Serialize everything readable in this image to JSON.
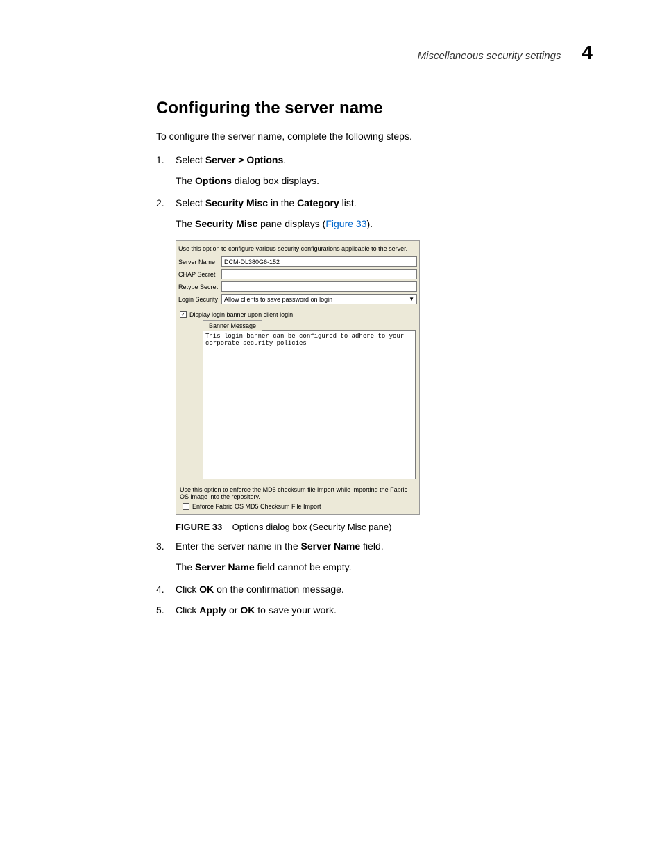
{
  "header": {
    "section_title": "Miscellaneous security settings",
    "chapter_number": "4"
  },
  "h1": "Configuring the server name",
  "intro": "To configure the server name, complete the following steps.",
  "steps": {
    "s1": {
      "num": "1.",
      "prefix": "Select ",
      "bold": "Server > Options",
      "suffix": ".",
      "result_pre": "The ",
      "result_bold": "Options",
      "result_post": " dialog box displays."
    },
    "s2": {
      "num": "2.",
      "prefix": "Select ",
      "bold1": "Security Misc",
      "mid": " in the ",
      "bold2": "Category",
      "suffix": " list.",
      "result_pre": "The ",
      "result_bold": "Security Misc",
      "result_mid": " pane displays (",
      "result_link": "Figure 33",
      "result_post": ")."
    },
    "s3": {
      "num": "3.",
      "prefix": "Enter the server name in the ",
      "bold": "Server Name",
      "suffix": " field.",
      "result_pre": "The ",
      "result_bold": "Server Name",
      "result_post": " field cannot be empty."
    },
    "s4": {
      "num": "4.",
      "prefix": "Click ",
      "bold": "OK",
      "suffix": " on the confirmation message."
    },
    "s5": {
      "num": "5.",
      "prefix": "Click ",
      "bold1": "Apply",
      "mid": " or ",
      "bold2": "OK",
      "suffix": " to save your work."
    }
  },
  "figure": {
    "label": "FIGURE 33",
    "caption": "Options dialog box (Security Misc pane)"
  },
  "pane": {
    "top_desc": "Use this option to configure various security configurations applicable to the server.",
    "server_name_label": "Server Name",
    "server_name_value": "DCM-DL380G6-152",
    "chap_secret_label": "CHAP Secret",
    "retype_secret_label": "Retype Secret",
    "login_security_label": "Login Security",
    "login_security_value": "Allow clients to save password on login",
    "display_banner_label": "Display login banner upon client login",
    "banner_tab_label": "Banner Message",
    "banner_text": "This login banner can be configured to adhere to your corporate security policies",
    "md5_desc": "Use this option to enforce the MD5 checksum file import while importing the Fabric OS image into the repository.",
    "md5_checkbox_label": "Enforce Fabric OS MD5 Checksum File Import"
  }
}
